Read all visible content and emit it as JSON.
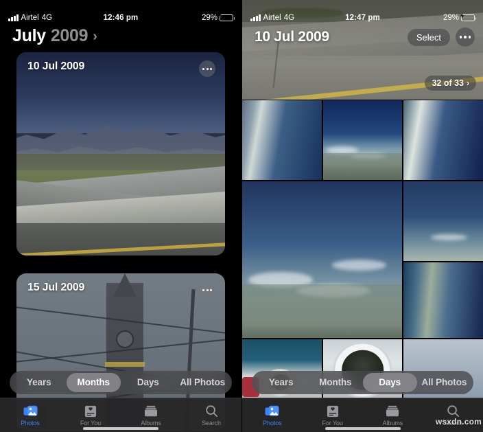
{
  "left": {
    "status": {
      "carrier": "Airtel",
      "network": "4G",
      "time": "12:46 pm",
      "battery_pct": "29%",
      "signal_icon": "signal-bars-icon",
      "battery_icon": "battery-charging-icon"
    },
    "header": {
      "month": "July",
      "year": "2009",
      "chevron": "›"
    },
    "cards": [
      {
        "label": "10 Jul 2009",
        "menu_icon": "ellipsis-icon",
        "art": "highway-mountains"
      },
      {
        "label": "15 Jul 2009",
        "menu_icon": "ellipsis-icon",
        "art": "clock-tower-wires"
      }
    ],
    "segmented": {
      "options": [
        "Years",
        "Months",
        "Days",
        "All Photos"
      ],
      "selected": "Months"
    },
    "tabs": [
      {
        "label": "Photos",
        "icon": "photos-icon",
        "active": true
      },
      {
        "label": "For You",
        "icon": "for-you-icon",
        "active": false
      },
      {
        "label": "Albums",
        "icon": "albums-icon",
        "active": false
      },
      {
        "label": "Search",
        "icon": "search-icon",
        "active": false
      }
    ]
  },
  "right": {
    "status": {
      "carrier": "Airtel",
      "network": "4G",
      "time": "12:47 pm",
      "battery_pct": "29%",
      "signal_icon": "signal-bars-icon",
      "battery_icon": "battery-charging-icon"
    },
    "header": {
      "title": "10 Jul 2009",
      "select_label": "Select",
      "menu_icon": "ellipsis-icon"
    },
    "count_pill": {
      "text": "32 of 33",
      "chevron": "›"
    },
    "segmented": {
      "options": [
        "Years",
        "Months",
        "Days",
        "All Photos"
      ],
      "selected": "Days"
    },
    "tabs": [
      {
        "label": "Photos",
        "icon": "photos-icon",
        "active": true
      },
      {
        "label": "For You",
        "icon": "for-you-icon",
        "active": false
      },
      {
        "label": "Albums",
        "icon": "albums-icon",
        "active": false
      },
      {
        "label": "Search",
        "icon": "search-icon",
        "active": false
      }
    ],
    "grid": [
      {
        "art": "sky-a",
        "name": "photo-thumb-1"
      },
      {
        "art": "sky-b",
        "name": "photo-thumb-2"
      },
      {
        "art": "sky-c",
        "name": "photo-thumb-3"
      },
      {
        "art": "sky-d",
        "name": "photo-thumb-4"
      },
      {
        "art": "sky-e",
        "name": "photo-thumb-5"
      },
      {
        "art": "sky-f",
        "name": "photo-thumb-6"
      },
      {
        "art": "sky-g",
        "name": "photo-thumb-7"
      },
      {
        "art": "sky-h",
        "name": "photo-thumb-8"
      },
      {
        "art": "food",
        "name": "photo-thumb-9"
      },
      {
        "art": "engine",
        "name": "photo-thumb-10"
      },
      {
        "art": "sky-i",
        "name": "photo-thumb-11"
      }
    ]
  },
  "watermark": "wsxdn.com",
  "colors": {
    "accent": "#3b82f6",
    "inactive": "#8e8e93",
    "battery": "#f3c018",
    "background": "#000000"
  }
}
